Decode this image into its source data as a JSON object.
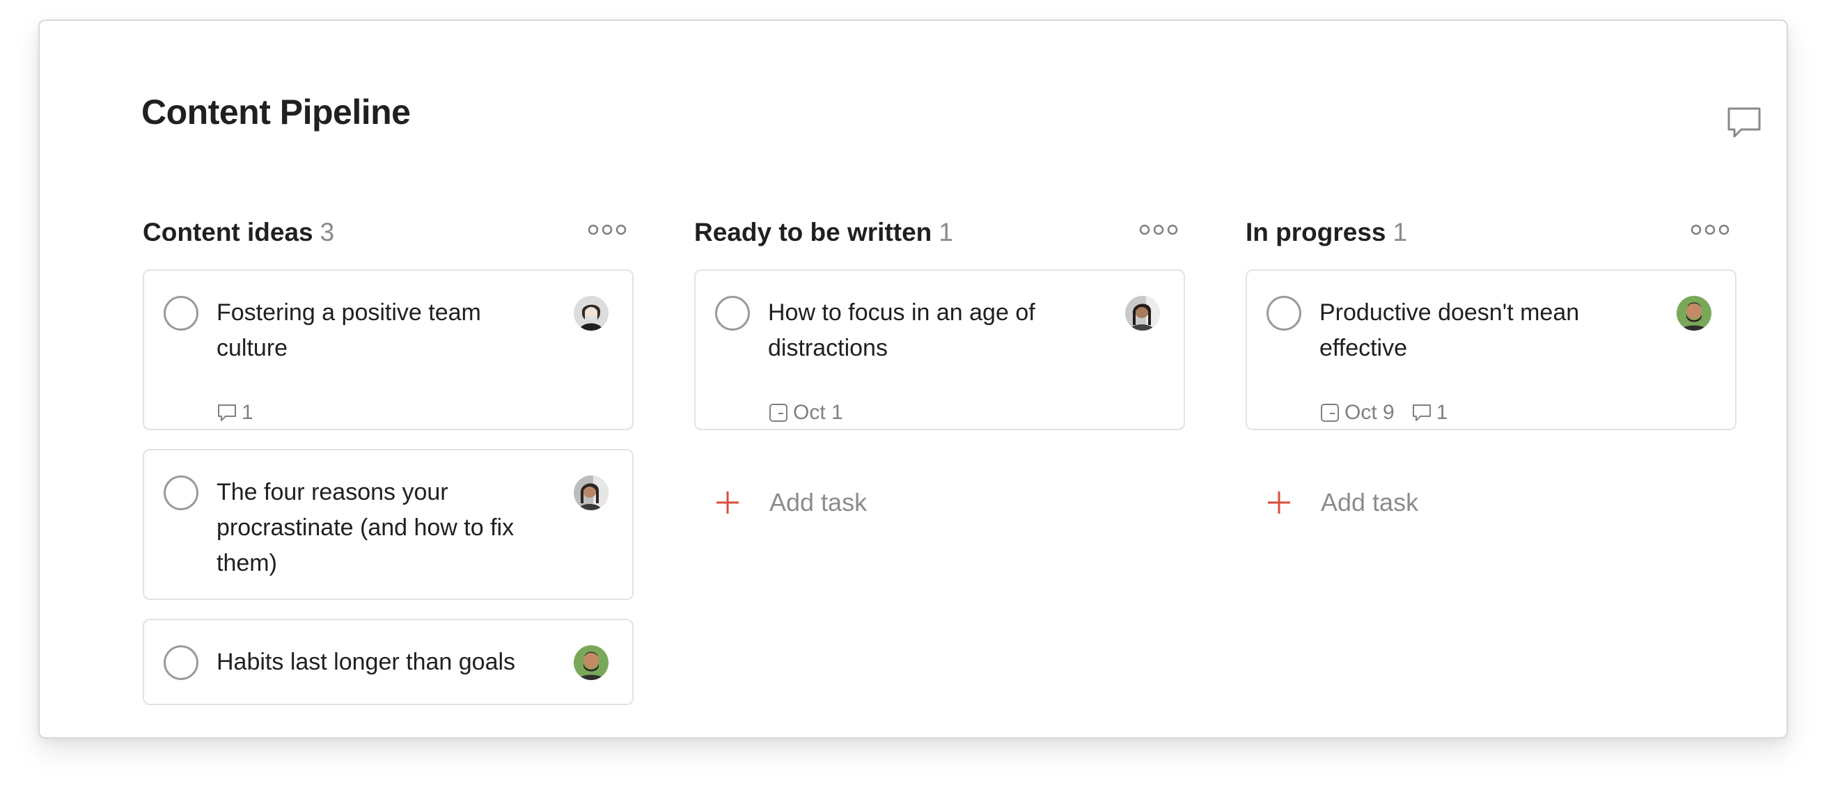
{
  "project": {
    "title": "Content Pipeline"
  },
  "colors": {
    "accent": "#db4c3f",
    "text": "#202020",
    "muted": "#808080",
    "border": "#e3e3e3"
  },
  "icons": {
    "comments": "speech-bubble-icon",
    "more": "more-horizontal-icon",
    "complete": "circle-checkbox-icon",
    "date": "calendar-icon",
    "comment": "comment-icon",
    "add": "plus-icon"
  },
  "columns": [
    {
      "title": "Content ideas",
      "count": "3",
      "cards": [
        {
          "title": "Fostering a positive team culture",
          "comments": "1"
        },
        {
          "title": "The four reasons your procrastinate (and how to fix them)"
        },
        {
          "title": "Habits last longer than goals"
        }
      ]
    },
    {
      "title": "Ready to be written",
      "count": "1",
      "cards": [
        {
          "title": "How to focus in an age of distractions",
          "date": "Oct 1"
        }
      ],
      "add_label": "Add task"
    },
    {
      "title": "In progress",
      "count": "1",
      "cards": [
        {
          "title": "Productive doesn't mean effective",
          "date": "Oct 9",
          "comments": "1"
        }
      ],
      "add_label": "Add task"
    }
  ]
}
